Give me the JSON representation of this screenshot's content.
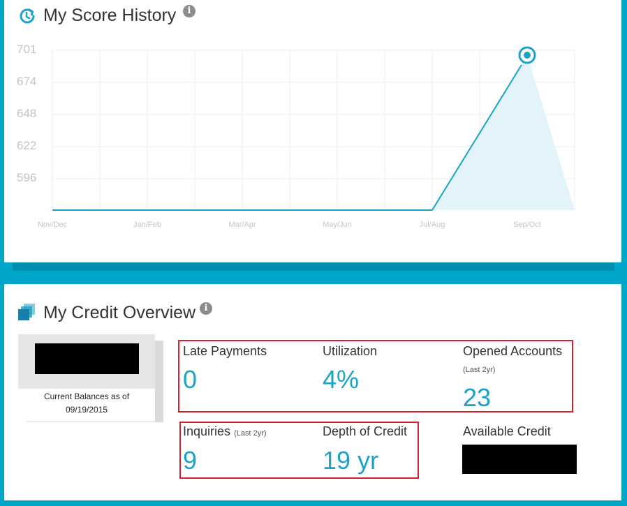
{
  "score_history": {
    "title": "My Score History",
    "info_icon": "info-icon",
    "history_icon": "clock-arrow-icon",
    "chart_data": {
      "type": "area",
      "title": "",
      "xlabel": "",
      "ylabel": "",
      "categories": [
        "Nov/Dec",
        "Jan/Feb",
        "Mar/Apr",
        "May/Jun",
        "Jul/Aug",
        "Sep/Oct"
      ],
      "y_ticks": [
        "701",
        "674",
        "648",
        "622",
        "596"
      ],
      "ylim": [
        570,
        701
      ],
      "grid": true,
      "series": [
        {
          "values": [
            null,
            null,
            null,
            null,
            null,
            697
          ]
        }
      ],
      "highlight_point": {
        "category": "Sep/Oct",
        "value": 697
      },
      "colors": {
        "line": "#1aa3c8",
        "fill": "#e2f3fa",
        "grid": "#ececec"
      }
    }
  },
  "credit_overview": {
    "title": "My Credit Overview",
    "overview_icon": "stacked-pages-icon",
    "info_icon": "info-icon",
    "balances_caption_line1": "Current Balances as of",
    "balances_caption_line2": "09/19/2015",
    "metrics": {
      "late_payments": {
        "label": "Late Payments",
        "value": "0"
      },
      "utilization": {
        "label": "Utilization",
        "value": "4%"
      },
      "opened_accounts": {
        "label": "Opened Accounts",
        "note": "(Last 2yr)",
        "value": "23"
      },
      "inquiries": {
        "label": "Inquiries",
        "note": "(Last 2yr)",
        "value": "9"
      },
      "depth_of_credit": {
        "label": "Depth of Credit",
        "value": "19 yr"
      },
      "available_credit": {
        "label": "Available Credit"
      }
    }
  }
}
